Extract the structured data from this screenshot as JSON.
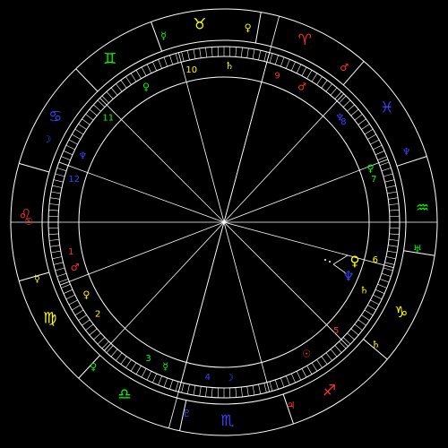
{
  "chart_data": {
    "type": "natal-wheel",
    "zodiac_signs": [
      {
        "symbol": "♉",
        "name": "Taurus",
        "color": "#ffff00",
        "angle": 263
      },
      {
        "symbol": "♈",
        "name": "Aries",
        "color": "#ff3030",
        "angle": 294
      },
      {
        "symbol": "♓",
        "name": "Pisces",
        "color": "#4040ff",
        "angle": 325
      },
      {
        "symbol": "♒",
        "name": "Aquarius",
        "color": "#00ff00",
        "angle": 356
      },
      {
        "symbol": "♑",
        "name": "Capricorn",
        "color": "#ffff00",
        "angle": 27
      },
      {
        "symbol": "♐",
        "name": "Sagittarius",
        "color": "#ff3030",
        "angle": 58
      },
      {
        "symbol": "♏",
        "name": "Scorpio",
        "color": "#4040ff",
        "angle": 89
      },
      {
        "symbol": "♎",
        "name": "Libra",
        "color": "#00ff00",
        "angle": 120
      },
      {
        "symbol": "♍",
        "name": "Virgo",
        "color": "#ffff00",
        "angle": 151
      },
      {
        "symbol": "♌",
        "name": "Leo",
        "color": "#ff3030",
        "angle": 182
      },
      {
        "symbol": "♋",
        "name": "Cancer",
        "color": "#4040ff",
        "angle": 212
      },
      {
        "symbol": "♊",
        "name": "Gemini",
        "color": "#00ff00",
        "angle": 235
      }
    ],
    "sign_rulers": [
      {
        "glyph": "♀",
        "color": "#ffff00",
        "angle": 277
      },
      {
        "glyph": "♂",
        "color": "#ff3030",
        "angle": 308
      },
      {
        "glyph": "♆",
        "color": "#4040ff",
        "angle": 339
      },
      {
        "glyph": "♅",
        "color": "#00ff00",
        "angle": 8
      },
      {
        "glyph": "♄",
        "color": "#ffff00",
        "angle": 39
      },
      {
        "glyph": "♃",
        "color": "#ff3030",
        "angle": 70
      },
      {
        "glyph": "♇",
        "color": "#4040ff",
        "angle": 101
      },
      {
        "glyph": "♀",
        "color": "#00ff00",
        "angle": 132
      },
      {
        "glyph": "☿",
        "color": "#ffff00",
        "angle": 163
      },
      {
        "glyph": "☉",
        "color": "#ff3030",
        "angle": 180
      },
      {
        "glyph": "☽",
        "color": "#4040ff",
        "angle": 205
      },
      {
        "glyph": "☿",
        "color": "#00ff00",
        "angle": 252
      }
    ],
    "houses": [
      {
        "number": "1",
        "color": "#ff3030",
        "angle": 169,
        "ruler": "♂",
        "ruler_angle": 163
      },
      {
        "number": "2",
        "color": "#ffff00",
        "angle": 144,
        "ruler": "♀",
        "ruler_angle": 152
      },
      {
        "number": "3",
        "color": "#00ff00",
        "angle": 119,
        "ruler": "☿",
        "ruler_angle": 112
      },
      {
        "number": "4",
        "color": "#4040ff",
        "angle": 96,
        "ruler": "☽",
        "ruler_angle": 88
      },
      {
        "number": "5",
        "color": "#ff3030",
        "angle": 44,
        "ruler": "☉",
        "ruler_angle": 58
      },
      {
        "number": "6",
        "color": "#ffff00",
        "angle": 14,
        "ruler": "♄",
        "ruler_angle": 26
      },
      {
        "number": "7",
        "color": "#00ff00",
        "angle": 344,
        "ruler": "♀",
        "ruler_angle": 340
      },
      {
        "number": "8",
        "color": "#4040ff",
        "angle": 320,
        "ruler": "♆",
        "ruler_angle": 318
      },
      {
        "number": "9",
        "color": "#ff3030",
        "angle": 290,
        "ruler": "♂",
        "ruler_angle": 300
      },
      {
        "number": "10",
        "color": "#ffff00",
        "angle": 258,
        "ruler": "♄",
        "ruler_angle": 272
      },
      {
        "number": "11",
        "color": "#00ff00",
        "angle": 222,
        "ruler": "♀",
        "ruler_angle": 240
      },
      {
        "number": "12",
        "color": "#4040ff",
        "angle": 196,
        "ruler": "♆",
        "ruler_angle": 205
      }
    ],
    "zodiac_boundaries_deg": [
      280,
      311,
      342,
      9,
      40,
      71,
      102,
      133,
      164,
      196,
      226,
      250
    ],
    "house_cusps_deg": [
      180,
      159,
      133,
      105,
      75,
      45,
      15,
      0,
      339,
      313,
      285,
      255,
      225,
      200
    ],
    "planets": [
      {
        "glyph": "♀",
        "color": "#ffff00",
        "angle": 4,
        "radius": 150
      },
      {
        "glyph": "♆",
        "color": "#4040ff",
        "angle": 12,
        "radius": 150
      }
    ]
  }
}
